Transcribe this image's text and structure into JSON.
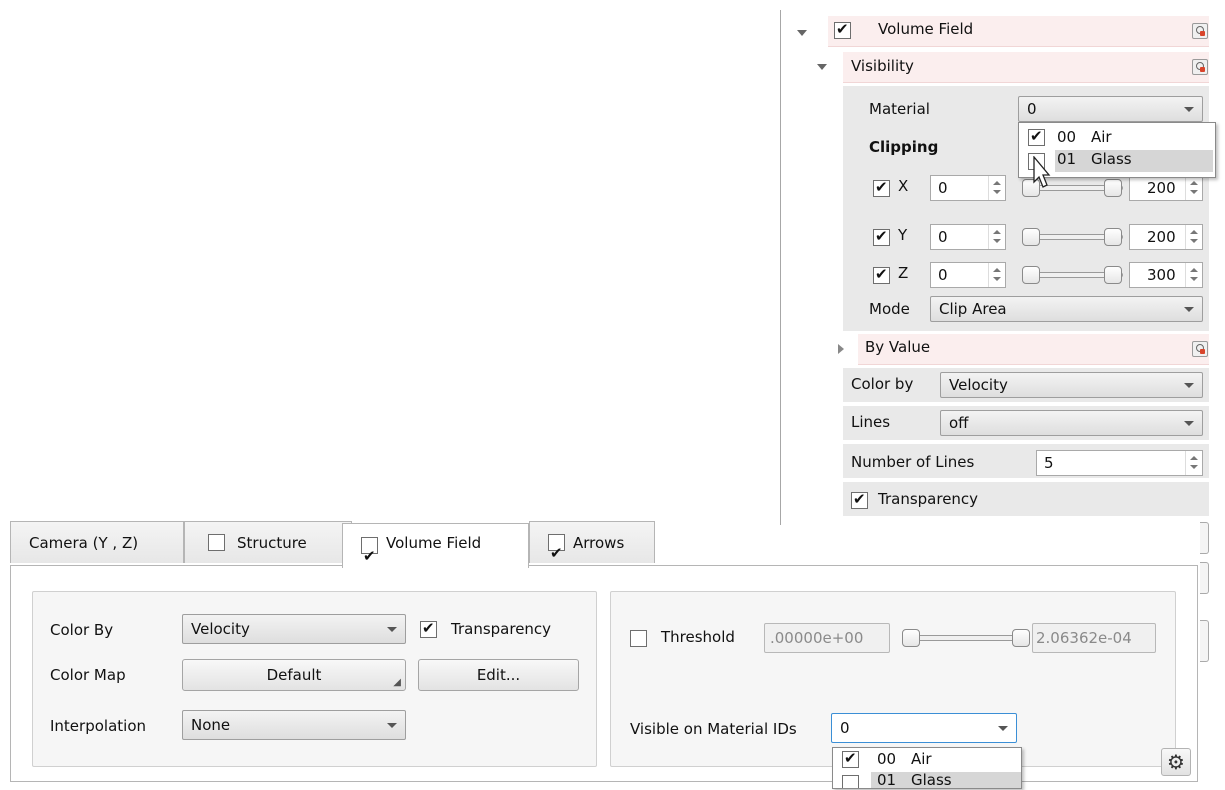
{
  "right_panel": {
    "volume_field": {
      "label": "Volume Field",
      "checked": true
    },
    "visibility": {
      "label": "Visibility"
    },
    "material": {
      "label": "Material",
      "value": "0",
      "options": [
        {
          "id": "00",
          "name": "Air",
          "checked": true
        },
        {
          "id": "01",
          "name": "Glass",
          "checked": false
        }
      ]
    },
    "clipping": {
      "label": "Clipping",
      "axes": [
        {
          "name": "X",
          "checked": true,
          "min": "0",
          "max": "200"
        },
        {
          "name": "Y",
          "checked": true,
          "min": "0",
          "max": "200"
        },
        {
          "name": "Z",
          "checked": true,
          "min": "0",
          "max": "300"
        }
      ],
      "mode_label": "Mode",
      "mode_value": "Clip Area"
    },
    "by_value": {
      "label": "By Value"
    },
    "color_by": {
      "label": "Color by",
      "value": "Velocity"
    },
    "lines": {
      "label": "Lines",
      "value": "off"
    },
    "number_of_lines": {
      "label": "Number of Lines",
      "value": "5"
    },
    "transparency": {
      "label": "Transparency",
      "checked": true
    }
  },
  "bottom_panel": {
    "tabs": [
      {
        "label": "Camera (Y , Z)",
        "has_checkbox": false
      },
      {
        "label": "Structure",
        "has_checkbox": true,
        "checked": false
      },
      {
        "label": "Volume Field",
        "has_checkbox": true,
        "checked": true,
        "active": true
      },
      {
        "label": "Arrows",
        "has_checkbox": true,
        "checked": true
      }
    ],
    "color_by": {
      "label": "Color By",
      "value": "Velocity"
    },
    "transparency": {
      "label": "Transparency",
      "checked": true
    },
    "color_map": {
      "label": "Color Map",
      "value": "Default",
      "edit_label": "Edit..."
    },
    "interpolation": {
      "label": "Interpolation",
      "value": "None"
    },
    "threshold": {
      "label": "Threshold",
      "checked": false,
      "min": ".00000e+00",
      "max": "2.06362e-04"
    },
    "visible_material": {
      "label": "Visible on Material IDs",
      "value": "0",
      "options": [
        {
          "id": "00",
          "name": "Air",
          "checked": true
        },
        {
          "id": "01",
          "name": "Glass",
          "checked": false
        }
      ]
    }
  },
  "colors": {
    "pink_row": "#fbeeee",
    "selection": "#d6d6d6",
    "focus_border": "#3b8fd6"
  }
}
